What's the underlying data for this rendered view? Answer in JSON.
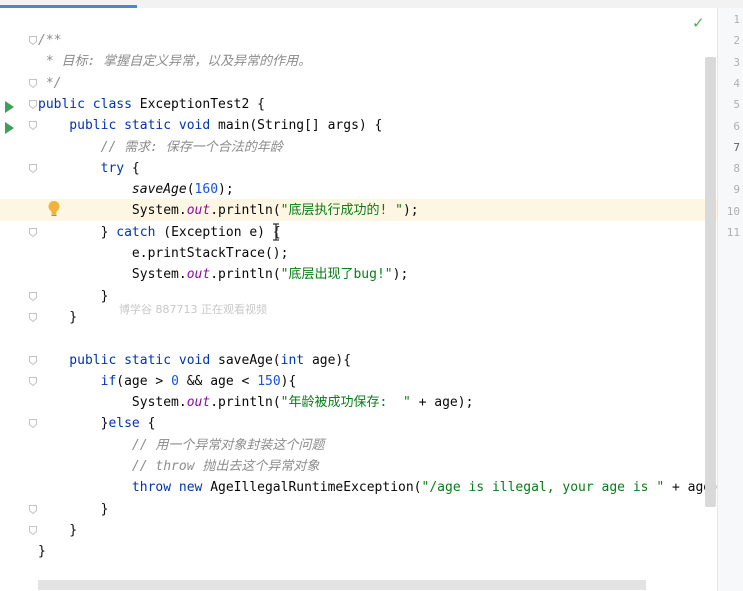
{
  "editor": {
    "lines": [
      {
        "parts": [
          {
            "t": "/**",
            "c": "cm"
          }
        ]
      },
      {
        "parts": [
          {
            "t": " * 目标: 掌握自定义异常，以及异常的作用。",
            "c": "cm"
          }
        ]
      },
      {
        "parts": [
          {
            "t": " */",
            "c": "cm"
          }
        ]
      },
      {
        "parts": [
          {
            "t": "public class ",
            "c": "kw"
          },
          {
            "t": "ExceptionTest2 {",
            "c": ""
          }
        ]
      },
      {
        "parts": [
          {
            "t": "    public static void ",
            "c": "kw"
          },
          {
            "t": "main(String[] args) {",
            "c": ""
          }
        ]
      },
      {
        "parts": [
          {
            "t": "        // 需求: 保存一个合法的年龄",
            "c": "cm"
          }
        ]
      },
      {
        "parts": [
          {
            "t": "        try ",
            "c": "kw"
          },
          {
            "t": "{",
            "c": ""
          }
        ]
      },
      {
        "parts": [
          {
            "t": "            ",
            "c": ""
          },
          {
            "t": "saveAge",
            "c": "itl"
          },
          {
            "t": "(",
            "c": ""
          },
          {
            "t": "160",
            "c": "num"
          },
          {
            "t": ");",
            "c": ""
          }
        ]
      },
      {
        "parts": [
          {
            "t": "            System.",
            "c": ""
          },
          {
            "t": "out",
            "c": "fld"
          },
          {
            "t": ".println(",
            "c": ""
          },
          {
            "t": "\"底层执行成功的! \"",
            "c": "str"
          },
          {
            "t": ");",
            "c": ""
          }
        ]
      },
      {
        "parts": [
          {
            "t": "        } ",
            "c": ""
          },
          {
            "t": "catch ",
            "c": "kw"
          },
          {
            "t": "(Exception e) {",
            "c": ""
          }
        ]
      },
      {
        "parts": [
          {
            "t": "            e.printStackTrace();",
            "c": ""
          }
        ]
      },
      {
        "parts": [
          {
            "t": "            System.",
            "c": ""
          },
          {
            "t": "out",
            "c": "fld"
          },
          {
            "t": ".println(",
            "c": ""
          },
          {
            "t": "\"底层出现了bug!\"",
            "c": "str"
          },
          {
            "t": ");",
            "c": ""
          }
        ]
      },
      {
        "parts": [
          {
            "t": "        }",
            "c": ""
          }
        ]
      },
      {
        "parts": [
          {
            "t": "    }",
            "c": ""
          }
        ]
      },
      {
        "parts": [
          {
            "t": "",
            "c": ""
          }
        ]
      },
      {
        "parts": [
          {
            "t": "    public static void ",
            "c": "kw"
          },
          {
            "t": "saveAge(",
            "c": ""
          },
          {
            "t": "int ",
            "c": "kw"
          },
          {
            "t": "age){",
            "c": ""
          }
        ]
      },
      {
        "parts": [
          {
            "t": "        if",
            "c": "kw"
          },
          {
            "t": "(age > ",
            "c": ""
          },
          {
            "t": "0",
            "c": "num"
          },
          {
            "t": " && age < ",
            "c": ""
          },
          {
            "t": "150",
            "c": "num"
          },
          {
            "t": "){",
            "c": ""
          }
        ]
      },
      {
        "parts": [
          {
            "t": "            System.",
            "c": ""
          },
          {
            "t": "out",
            "c": "fld"
          },
          {
            "t": ".println(",
            "c": ""
          },
          {
            "t": "\"年龄被成功保存:  \"",
            "c": "str"
          },
          {
            "t": " + age);",
            "c": ""
          }
        ]
      },
      {
        "parts": [
          {
            "t": "        }",
            "c": ""
          },
          {
            "t": "else ",
            "c": "kw"
          },
          {
            "t": "{",
            "c": ""
          }
        ]
      },
      {
        "parts": [
          {
            "t": "            // 用一个异常对象封装这个问题",
            "c": "cm"
          }
        ]
      },
      {
        "parts": [
          {
            "t": "            // throw 抛出去这个异常对象",
            "c": "cm"
          }
        ]
      },
      {
        "parts": [
          {
            "t": "            throw new ",
            "c": "kw"
          },
          {
            "t": "AgeIllegalRuntimeException(",
            "c": ""
          },
          {
            "t": "\"/age is illegal, your age is \"",
            "c": "str"
          },
          {
            "t": " + age)",
            "c": ""
          }
        ]
      },
      {
        "parts": [
          {
            "t": "        }",
            "c": ""
          }
        ]
      },
      {
        "parts": [
          {
            "t": "    }",
            "c": ""
          }
        ]
      },
      {
        "parts": [
          {
            "t": "}",
            "c": ""
          }
        ]
      }
    ]
  },
  "right_gutter": {
    "line_numbers": [
      "1",
      "2",
      "3",
      "4",
      "5",
      "6",
      "7",
      "8",
      "9",
      "10",
      "11"
    ],
    "active_line": "7"
  },
  "watermark": "博学谷 887713 正在观看视频",
  "colors": {
    "keyword": "#0033b3",
    "comment": "#8c8c8c",
    "string": "#067d17",
    "number": "#1750eb",
    "field": "#871094"
  },
  "icons": [
    "run-icon",
    "fold-icon",
    "intention-bulb-icon",
    "inspection-ok-icon",
    "text-cursor-icon"
  ]
}
